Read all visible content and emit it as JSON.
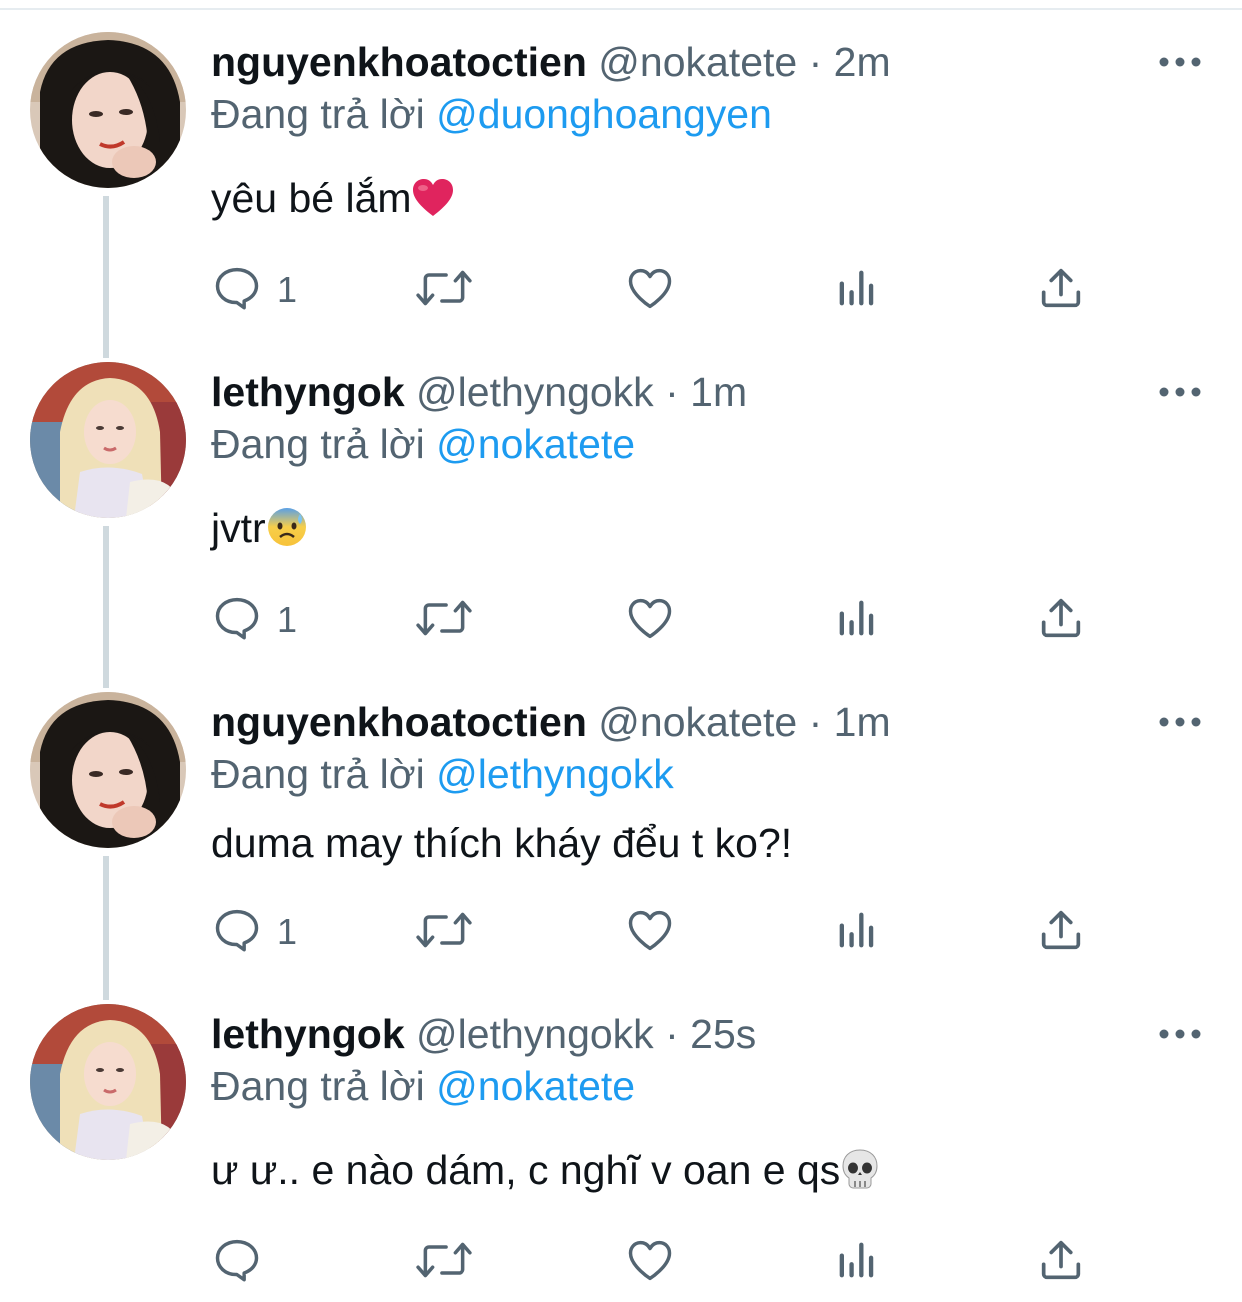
{
  "colors": {
    "text": "#0f1419",
    "secondary": "#536471",
    "link": "#1d9bf0",
    "thread_line": "#cfd9de",
    "heart_emoji": "#e0245e"
  },
  "reply_prefix": "Đang trả lời",
  "tweets": [
    {
      "display_name": "nguyenkhoatoctien",
      "handle": "@nokatete",
      "separator": "·",
      "time": "2m",
      "reply_to": "@duonghoangyen",
      "text": "yêu bé lắm",
      "emoji": "red-heart",
      "reply_count": "1",
      "avatar": "dark-hair-avatar"
    },
    {
      "display_name": "lethyngok",
      "handle": "@lethyngokk",
      "separator": "·",
      "time": "1m",
      "reply_to": "@nokatete",
      "text": "jvtr",
      "emoji": "anxious-face-with-sweat",
      "reply_count": "1",
      "avatar": "blonde-hair-avatar"
    },
    {
      "display_name": "nguyenkhoatoctien",
      "handle": "@nokatete",
      "separator": "·",
      "time": "1m",
      "reply_to": "@lethyngokk",
      "text": "duma may thích kháy đểu t ko?!",
      "emoji": "",
      "reply_count": "1",
      "avatar": "dark-hair-avatar"
    },
    {
      "display_name": "lethyngok",
      "handle": "@lethyngokk",
      "separator": "·",
      "time": "25s",
      "reply_to": "@nokatete",
      "text": "ư ư.. e nào dám, c nghĩ v oan e qs",
      "emoji": "skull",
      "reply_count": "",
      "avatar": "blonde-hair-avatar"
    }
  ]
}
